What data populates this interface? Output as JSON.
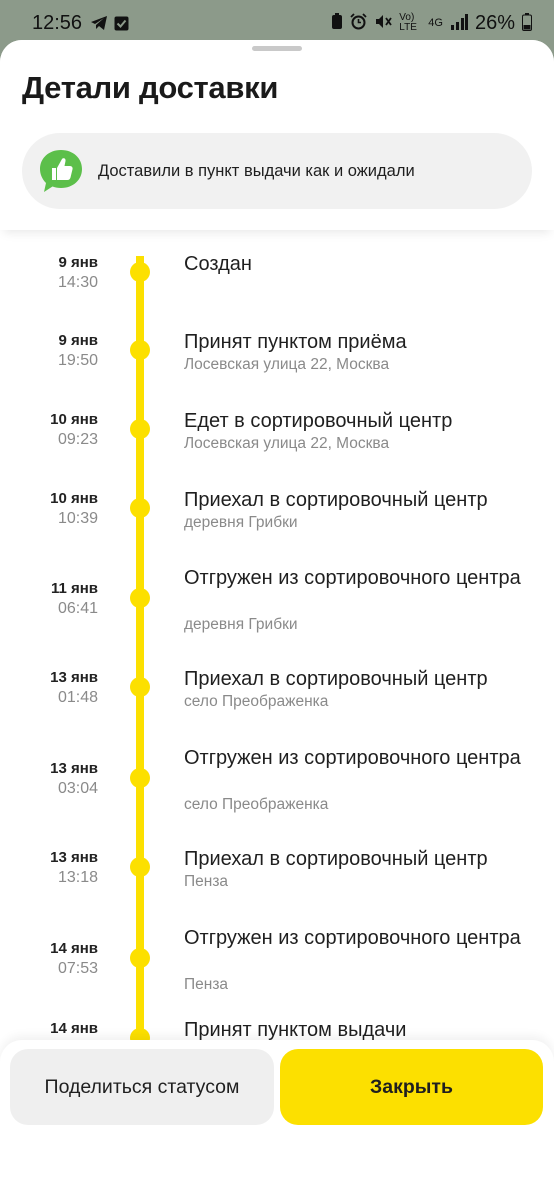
{
  "status_bar": {
    "time": "12:56",
    "network_label": "Vo) LTE",
    "signal_label": "4G",
    "battery_percent": "26%",
    "icons": [
      "telegram-icon",
      "check-square-icon",
      "battery-saver-icon",
      "alarm-icon",
      "mute-icon",
      "signal-icon",
      "battery-icon"
    ]
  },
  "header": {
    "title": "Детали доставки",
    "notice_text": "Доставили в пункт выдачи как и ожидали",
    "notice_icon": "thumbs-up-icon"
  },
  "timeline": [
    {
      "date": "9 янв",
      "time": "14:30",
      "title": "Создан",
      "subtitle": ""
    },
    {
      "date": "9 янв",
      "time": "19:50",
      "title": "Принят пунктом приёма",
      "subtitle": "Лосевская улица 22, Москва"
    },
    {
      "date": "10 янв",
      "time": "09:23",
      "title": "Едет в сортировочный центр",
      "subtitle": "Лосевская улица 22, Москва"
    },
    {
      "date": "10 янв",
      "time": "10:39",
      "title": "Приехал в сортировочный центр",
      "subtitle": "деревня Грибки"
    },
    {
      "date": "11 янв",
      "time": "06:41",
      "title": "Отгружен из сортировочного центра",
      "subtitle": "деревня Грибки"
    },
    {
      "date": "13 янв",
      "time": "01:48",
      "title": "Приехал в сортировочный центр",
      "subtitle": "село Преображенка"
    },
    {
      "date": "13 янв",
      "time": "03:04",
      "title": "Отгружен из сортировочного центра",
      "subtitle": "село Преображенка"
    },
    {
      "date": "13 янв",
      "time": "13:18",
      "title": "Приехал в сортировочный центр",
      "subtitle": "Пенза"
    },
    {
      "date": "14 янв",
      "time": "07:53",
      "title": "Отгружен из сортировочного центра",
      "subtitle": "Пенза"
    },
    {
      "date": "14 янв",
      "time": "",
      "title": "Принят пунктом выдачи",
      "subtitle": ""
    }
  ],
  "actions": {
    "share_label": "Поделиться статусом",
    "close_label": "Закрыть"
  },
  "colors": {
    "accent": "#fce000",
    "notice_bg": "#f1f1f1",
    "secondary_text": "#8a8a8a"
  }
}
